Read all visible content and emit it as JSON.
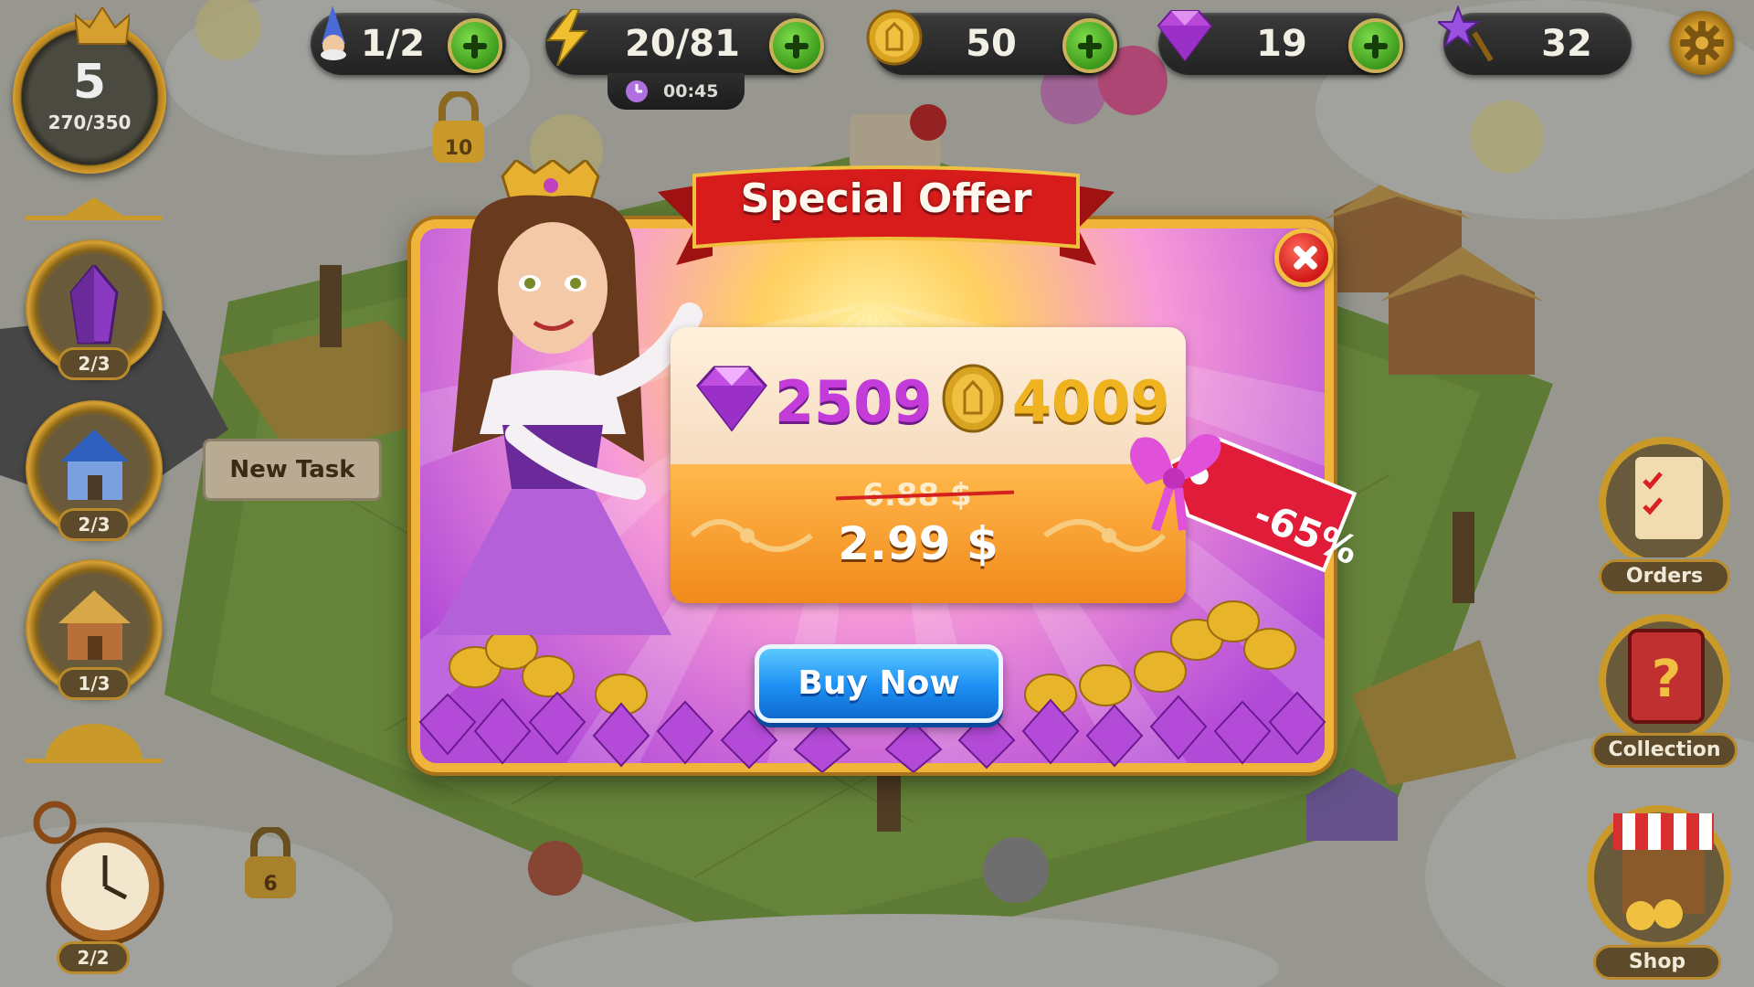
{
  "hud": {
    "level": "5",
    "xp": "270/350",
    "resources": [
      {
        "icon": "wizard-icon",
        "value": "1/2"
      },
      {
        "icon": "energy-lightning-icon",
        "value": "20/81"
      },
      {
        "icon": "gold-coin-icon",
        "value": "50"
      },
      {
        "icon": "purple-gem-icon",
        "value": "19"
      },
      {
        "icon": "magic-wand-star-icon",
        "value": "32"
      }
    ],
    "energy_timer": "00:45"
  },
  "left_panel": {
    "items": [
      {
        "icon": "purple-crystal-icon",
        "count": "2/3"
      },
      {
        "icon": "blue-house-icon",
        "count": "2/3"
      },
      {
        "icon": "cottage-icon",
        "count": "1/3"
      }
    ],
    "clock_count": "2/2",
    "new_task_label": "New Task"
  },
  "right_panel": {
    "orders_label": "Orders",
    "collection_label": "Collection",
    "shop_label": "Shop"
  },
  "map": {
    "lock_levels": [
      "10",
      "6"
    ]
  },
  "offer": {
    "title": "Special Offer",
    "gems": "2509",
    "coins": "4009",
    "old_price": "6.88 $",
    "new_price": "2.99 $",
    "discount": "-65%",
    "buy_label": "Buy Now"
  },
  "colors": {
    "dialog_gold": "#f0b43a",
    "ribbon_red": "#d81c1c",
    "buy_blue": "#1c8ef2",
    "gem_purple": "#c33bd8",
    "coin_gold": "#f0b320"
  }
}
